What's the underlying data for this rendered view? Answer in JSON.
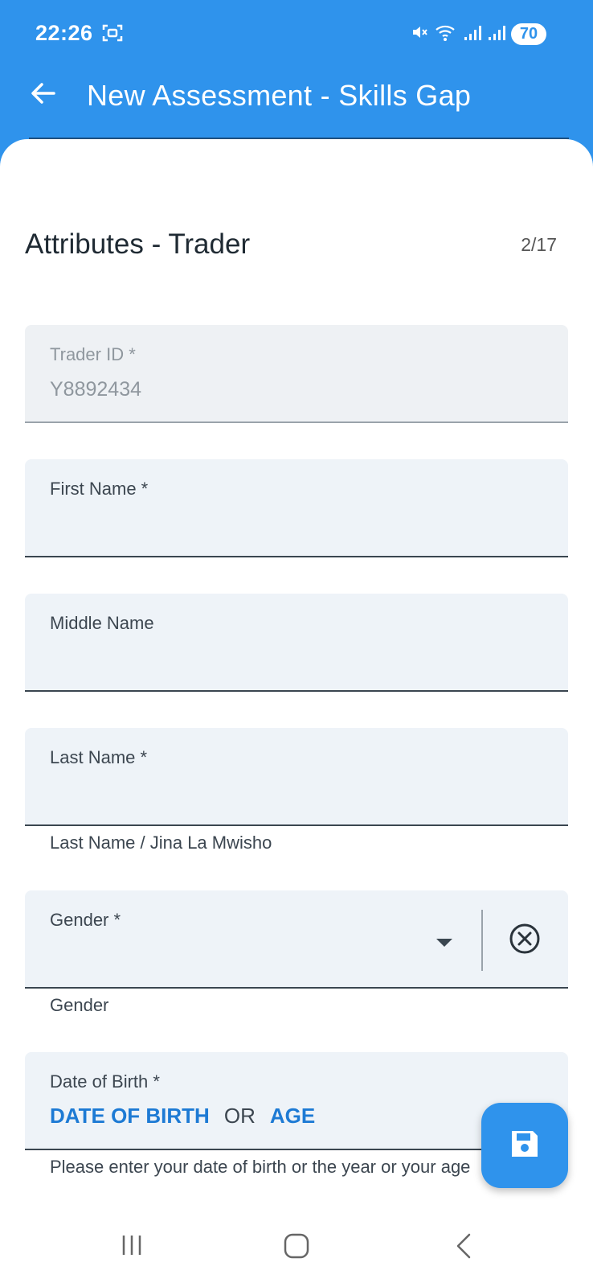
{
  "status_bar": {
    "time": "22:26",
    "battery": "70",
    "icons": [
      "screenshot-icon",
      "mute-icon",
      "wifi-icon",
      "signal-icon",
      "signal-icon",
      "battery-icon"
    ]
  },
  "app_bar": {
    "title": "New Assessment - Skills Gap",
    "back_icon": "arrow-left-icon"
  },
  "section": {
    "title": "Attributes - Trader",
    "page_counter": "2/17"
  },
  "fields": {
    "trader_id": {
      "label": "Trader ID *",
      "value": "Y8892434"
    },
    "first_name": {
      "label": "First Name *"
    },
    "middle_name": {
      "label": "Middle Name"
    },
    "last_name": {
      "label": "Last Name *",
      "helper": "Last Name / Jina La Mwisho"
    },
    "gender": {
      "label": "Gender *",
      "helper": "Gender"
    },
    "dob": {
      "label": "Date of Birth *",
      "option_dob": "DATE OF BIRTH",
      "separator": "OR",
      "option_age": "AGE",
      "helper": "Please enter your date of birth or the year or your age"
    }
  },
  "fab": {
    "icon": "save-icon"
  },
  "colors": {
    "primary": "#2f93ec",
    "link": "#1d7ad4",
    "field_bg": "#eef3f8"
  }
}
